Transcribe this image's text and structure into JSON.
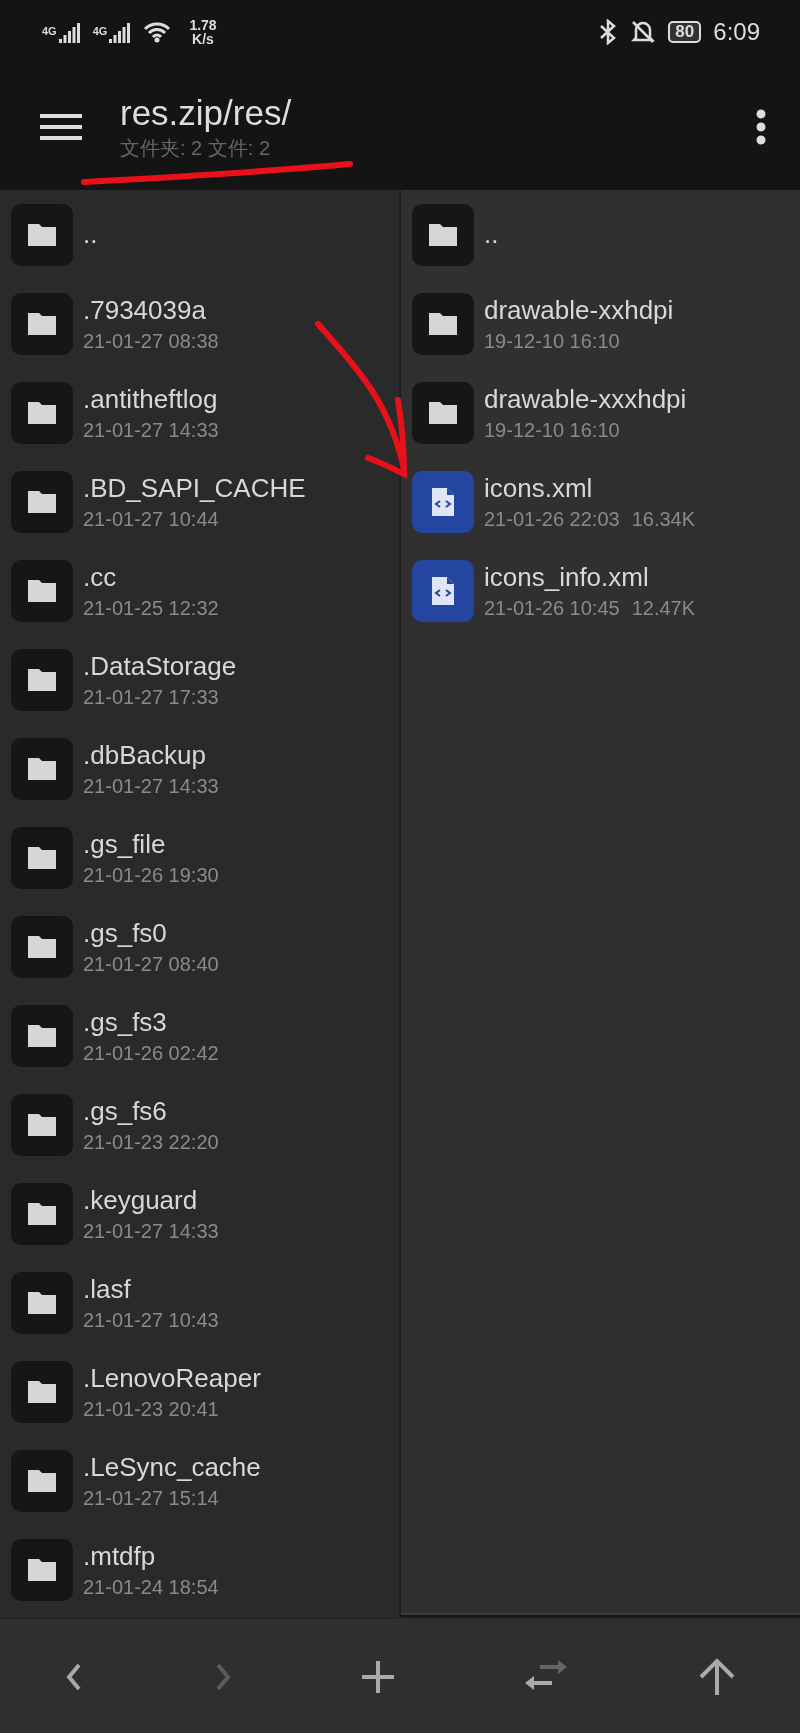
{
  "status_bar": {
    "sim_labels": [
      "4G",
      "4G"
    ],
    "speed": "1.78",
    "speed_unit": "K/s",
    "battery": "80",
    "time": "6:09"
  },
  "toolbar": {
    "title": "res.zip/res/",
    "subtitle": "文件夹: 2  文件: 2"
  },
  "left_pane": {
    "items": [
      {
        "kind": "folder",
        "name": ".."
      },
      {
        "kind": "folder",
        "name": ".7934039a",
        "date": "21-01-27 08:38"
      },
      {
        "kind": "folder",
        "name": ".antitheftlog",
        "date": "21-01-27 14:33"
      },
      {
        "kind": "folder",
        "name": ".BD_SAPI_CACHE",
        "date": "21-01-27 10:44"
      },
      {
        "kind": "folder",
        "name": ".cc",
        "date": "21-01-25 12:32"
      },
      {
        "kind": "folder",
        "name": ".DataStorage",
        "date": "21-01-27 17:33"
      },
      {
        "kind": "folder",
        "name": ".dbBackup",
        "date": "21-01-27 14:33"
      },
      {
        "kind": "folder",
        "name": ".gs_file",
        "date": "21-01-26 19:30"
      },
      {
        "kind": "folder",
        "name": ".gs_fs0",
        "date": "21-01-27 08:40"
      },
      {
        "kind": "folder",
        "name": ".gs_fs3",
        "date": "21-01-26 02:42"
      },
      {
        "kind": "folder",
        "name": ".gs_fs6",
        "date": "21-01-23 22:20"
      },
      {
        "kind": "folder",
        "name": ".keyguard",
        "date": "21-01-27 14:33"
      },
      {
        "kind": "folder",
        "name": ".lasf",
        "date": "21-01-27 10:43"
      },
      {
        "kind": "folder",
        "name": ".LenovoReaper",
        "date": "21-01-23 20:41"
      },
      {
        "kind": "folder",
        "name": ".LeSync_cache",
        "date": "21-01-27 15:14"
      },
      {
        "kind": "folder",
        "name": ".mtdfp",
        "date": "21-01-24 18:54"
      }
    ]
  },
  "right_pane": {
    "items": [
      {
        "kind": "folder",
        "name": ".."
      },
      {
        "kind": "folder",
        "name": "drawable-xxhdpi",
        "date": "19-12-10 16:10"
      },
      {
        "kind": "folder",
        "name": "drawable-xxxhdpi",
        "date": "19-12-10 16:10"
      },
      {
        "kind": "xml",
        "name": "icons.xml",
        "date": "21-01-26 22:03",
        "size": "16.34K"
      },
      {
        "kind": "xml",
        "name": "icons_info.xml",
        "date": "21-01-26 10:45",
        "size": "12.47K"
      }
    ]
  },
  "bottom_bar": [
    {
      "kind": "back",
      "disabled": false
    },
    {
      "kind": "forward",
      "disabled": true
    },
    {
      "kind": "add",
      "disabled": false
    },
    {
      "kind": "swap",
      "disabled": false
    },
    {
      "kind": "up",
      "disabled": false
    }
  ]
}
